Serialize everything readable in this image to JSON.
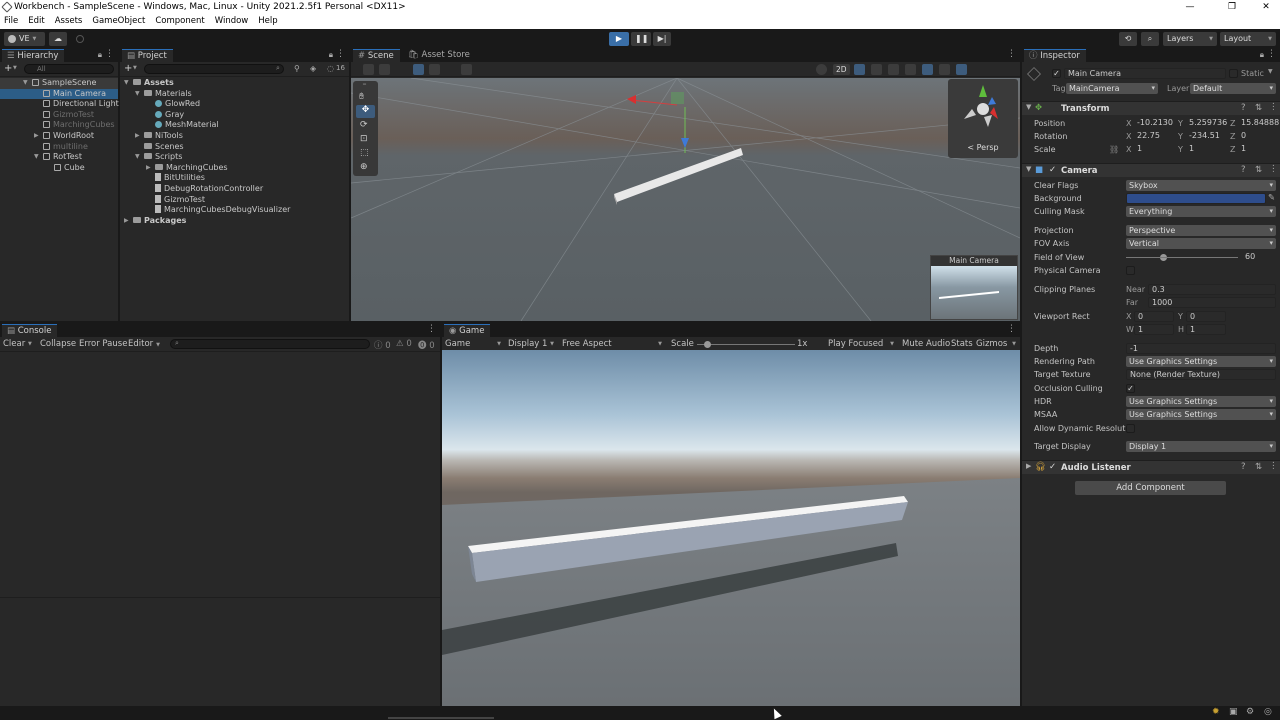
{
  "window": {
    "title": "Workbench - SampleScene - Windows, Mac, Linux - Unity 2021.2.5f1 Personal <DX11>"
  },
  "menu": [
    "File",
    "Edit",
    "Assets",
    "GameObject",
    "Component",
    "Window",
    "Help"
  ],
  "toolbar": {
    "account": "VE",
    "layers": "Layers",
    "layout": "Layout"
  },
  "hierarchy": {
    "tab": "Hierarchy",
    "search": "All",
    "items": [
      {
        "label": "SampleScene",
        "indent": 0,
        "arrow": "▼",
        "sel": true,
        "kind": "scene"
      },
      {
        "label": "Main Camera",
        "indent": 1,
        "kind": "obj",
        "sel": true
      },
      {
        "label": "Directional Light",
        "indent": 1,
        "kind": "obj"
      },
      {
        "label": "GizmoTest",
        "indent": 1,
        "kind": "obj",
        "dim": true
      },
      {
        "label": "MarchingCubes",
        "indent": 1,
        "kind": "obj",
        "dim": true
      },
      {
        "label": "WorldRoot",
        "indent": 1,
        "arrow": "▶",
        "kind": "obj"
      },
      {
        "label": "multiline",
        "indent": 1,
        "kind": "obj",
        "dim": true
      },
      {
        "label": "RotTest",
        "indent": 1,
        "arrow": "▼",
        "kind": "obj"
      },
      {
        "label": "Cube",
        "indent": 2,
        "kind": "obj"
      }
    ]
  },
  "project": {
    "tab": "Project",
    "count": "16",
    "items": [
      {
        "label": "Assets",
        "indent": 0,
        "arrow": "▼",
        "kind": "folder",
        "bold": true
      },
      {
        "label": "Materials",
        "indent": 1,
        "arrow": "▼",
        "kind": "folder"
      },
      {
        "label": "GlowRed",
        "indent": 2,
        "kind": "mat"
      },
      {
        "label": "Gray",
        "indent": 2,
        "kind": "mat"
      },
      {
        "label": "MeshMaterial",
        "indent": 2,
        "kind": "mat"
      },
      {
        "label": "NiTools",
        "indent": 1,
        "arrow": "▶",
        "kind": "folder"
      },
      {
        "label": "Scenes",
        "indent": 1,
        "kind": "folder"
      },
      {
        "label": "Scripts",
        "indent": 1,
        "arrow": "▼",
        "kind": "folder"
      },
      {
        "label": "MarchingCubes",
        "indent": 2,
        "arrow": "▶",
        "kind": "folder"
      },
      {
        "label": "BitUtilities",
        "indent": 2,
        "kind": "script"
      },
      {
        "label": "DebugRotationController",
        "indent": 2,
        "kind": "script"
      },
      {
        "label": "GizmoTest",
        "indent": 2,
        "kind": "script"
      },
      {
        "label": "MarchingCubesDebugVisualizer",
        "indent": 2,
        "kind": "script"
      },
      {
        "label": "Packages",
        "indent": 0,
        "arrow": "▶",
        "kind": "folder",
        "bold": true
      }
    ]
  },
  "scene": {
    "tab": "Scene",
    "tab2": "Asset Store",
    "btn2d": "2D",
    "persp": "< Persp",
    "preview_title": "Main Camera"
  },
  "console": {
    "tab": "Console",
    "clear": "Clear",
    "collapse": "Collapse",
    "error_pause": "Error Pause",
    "editor": "Editor",
    "c1": "0",
    "c2": "0",
    "c3": "0"
  },
  "game": {
    "tab": "Game",
    "display_mode": "Game",
    "display": "Display 1",
    "aspect": "Free Aspect",
    "scale": "Scale",
    "scale_val": "1x",
    "play_focused": "Play Focused",
    "mute": "Mute Audio",
    "stats": "Stats",
    "gizmos": "Gizmos",
    "scale_fraction": 0.1
  },
  "inspector": {
    "tab": "Inspector",
    "object_name": "Main Camera",
    "static": "Static",
    "tag_label": "Tag",
    "tag": "MainCamera",
    "layer_label": "Layer",
    "layer": "Default",
    "transform": {
      "title": "Transform",
      "position_label": "Position",
      "rotation_label": "Rotation",
      "scale_label": "Scale",
      "pos": [
        "-10.2130",
        "5.259736",
        "15.84888"
      ],
      "rot": [
        "22.75",
        "-234.51",
        "0"
      ],
      "scl": [
        "1",
        "1",
        "1"
      ]
    },
    "camera": {
      "title": "Camera",
      "rows": [
        {
          "label": "Clear Flags",
          "value": "Skybox",
          "type": "dd"
        },
        {
          "label": "Background",
          "value": "",
          "type": "color"
        },
        {
          "label": "Culling Mask",
          "value": "Everything",
          "type": "dd"
        },
        {
          "label": "Projection",
          "value": "Perspective",
          "type": "dd"
        },
        {
          "label": "FOV Axis",
          "value": "Vertical",
          "type": "dd"
        },
        {
          "label": "Field of View",
          "value": "60",
          "type": "slider"
        },
        {
          "label": "Physical Camera",
          "value": "",
          "type": "check"
        },
        {
          "label": "Clipping Planes",
          "value": "",
          "type": "label"
        },
        {
          "label": "Viewport Rect",
          "value": "",
          "type": "label"
        },
        {
          "label": "Depth",
          "value": "-1",
          "type": "field"
        },
        {
          "label": "Rendering Path",
          "value": "Use Graphics Settings",
          "type": "dd"
        },
        {
          "label": "Target Texture",
          "value": "None (Render Texture)",
          "type": "obj"
        },
        {
          "label": "Occlusion Culling",
          "value": "✓",
          "type": "check"
        },
        {
          "label": "HDR",
          "value": "Use Graphics Settings",
          "type": "dd"
        },
        {
          "label": "MSAA",
          "value": "Use Graphics Settings",
          "type": "dd"
        },
        {
          "label": "Allow Dynamic Resoluti",
          "value": "",
          "type": "check"
        },
        {
          "label": "Target Display",
          "value": "Display 1",
          "type": "dd"
        }
      ],
      "near_label": "Near",
      "near": "0.3",
      "far_label": "Far",
      "far": "1000",
      "vp": {
        "x_label": "X",
        "x": "0",
        "y_label": "Y",
        "y": "0",
        "w_label": "W",
        "w": "1",
        "h_label": "H",
        "h": "1"
      },
      "fov_fraction": 0.33,
      "bg_color": "#2e4d8c"
    },
    "audio": {
      "title": "Audio Listener"
    },
    "add_component": "Add Component"
  }
}
